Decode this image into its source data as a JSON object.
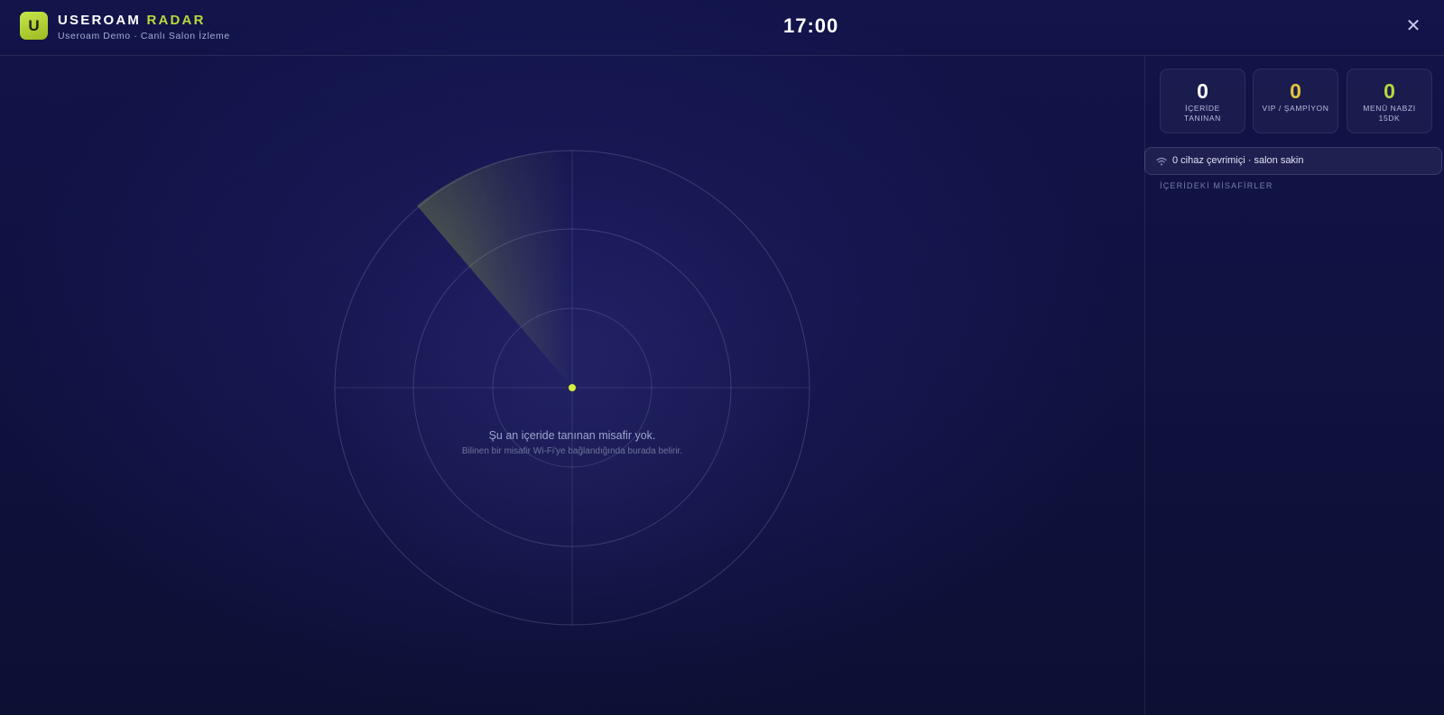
{
  "header": {
    "logo_letter": "U",
    "brand_main": "USEROAM",
    "brand_accent": "RADAR",
    "subtitle": "Useroam Demo · Canlı Salon İzleme",
    "clock": "17:00",
    "close_glyph": "✕"
  },
  "radar": {
    "empty_title": "Şu an içeride tanınan misafir yok.",
    "empty_subtitle": "Bilinen bir misafir Wi-Fi'ye bağlandığında burada belirir."
  },
  "stats": [
    {
      "value": "0",
      "label": "İÇERİDE TANINAN",
      "color": "#ffffff"
    },
    {
      "value": "0",
      "label": "VIP / ŞAMPİYON",
      "color": "#e5c43a"
    },
    {
      "value": "0",
      "label": "MENÜ NABZI 15DK",
      "color": "#b9d93b"
    }
  ],
  "wifi": {
    "icon": "wifi-icon",
    "text": "0 cihaz çevrimiçi · salon sakin"
  },
  "guests": {
    "section_label": "İÇERİDEKİ MİSAFİRLER"
  },
  "colors": {
    "accent": "#b9d93b",
    "gold": "#e5c43a",
    "background": "#11133f"
  }
}
